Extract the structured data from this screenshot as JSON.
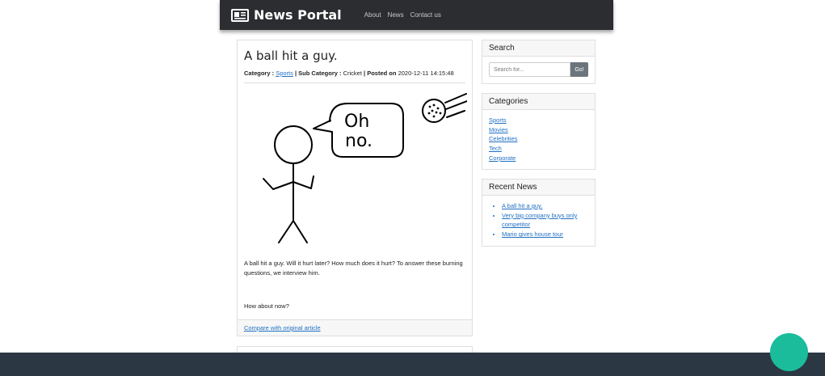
{
  "navbar": {
    "brand": "News Portal",
    "brand_icon": "newspaper-icon",
    "links": [
      "About",
      "News",
      "Contact us"
    ]
  },
  "post": {
    "title": "A ball hit a guy.",
    "category_label": "Category :",
    "category": "Sports",
    "subcategory_label": "| Sub Category :",
    "subcategory": "Cricket",
    "posted_label": "| Posted on",
    "posted_on": "2020-12-11 14:15:48",
    "image_speech_line1": "Oh",
    "image_speech_line2": "no.",
    "paragraph1": "A ball hit a guy. Will it hurt later? How much does it hurt? To answer these burning questions, we interview him.",
    "paragraph2": "How about now?",
    "footer_link": "Compare with original article"
  },
  "sidebar": {
    "search": {
      "title": "Search",
      "placeholder": "Search for...",
      "button": "Go!"
    },
    "categories": {
      "title": "Categories",
      "items": [
        "Sports",
        "Movies",
        "Celebrities",
        "Tech",
        "Corporate"
      ]
    },
    "recent": {
      "title": "Recent News",
      "items": [
        "A ball hit a guy.",
        "Very big company buys only competitor",
        "Mario gives house tour"
      ]
    }
  },
  "colors": {
    "navbar": "#2b2d30",
    "link": "#1f6fc2",
    "footer": "#2c3744",
    "fab": "#1abc9c"
  }
}
